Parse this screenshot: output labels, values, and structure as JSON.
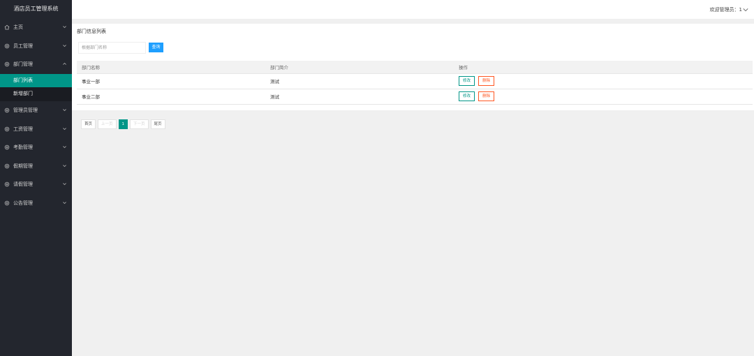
{
  "app": {
    "title": "酒店员工管理系统"
  },
  "header": {
    "welcome": "欢迎管理员：1"
  },
  "sidebar": {
    "items": [
      {
        "label": "主页",
        "icon": "home-icon",
        "chevron": "chevron-down-icon"
      },
      {
        "label": "员工管理",
        "icon": "settings-icon",
        "chevron": "chevron-down-icon"
      },
      {
        "label": "部门管理",
        "icon": "settings-icon",
        "chevron": "chevron-up-icon",
        "children": [
          {
            "label": "部门列表",
            "active": true
          },
          {
            "label": "新增部门",
            "active": false
          }
        ]
      },
      {
        "label": "管理员管理",
        "icon": "settings-icon",
        "chevron": "chevron-down-icon"
      },
      {
        "label": "工资管理",
        "icon": "settings-icon",
        "chevron": "chevron-down-icon"
      },
      {
        "label": "考勤管理",
        "icon": "settings-icon",
        "chevron": "chevron-down-icon"
      },
      {
        "label": "假期管理",
        "icon": "settings-icon",
        "chevron": "chevron-down-icon"
      },
      {
        "label": "请假管理",
        "icon": "settings-icon",
        "chevron": "chevron-down-icon"
      },
      {
        "label": "公告管理",
        "icon": "settings-icon",
        "chevron": "chevron-down-icon"
      }
    ]
  },
  "main": {
    "title": "部门信息列表",
    "search": {
      "placeholder": "根据部门名称",
      "value": "",
      "button": "查询"
    },
    "table": {
      "headers": [
        "部门名称",
        "部门简介",
        "操作"
      ],
      "rows": [
        {
          "name": "事业一部",
          "desc": "测试",
          "edit": "修改",
          "delete": "删除"
        },
        {
          "name": "事业二部",
          "desc": "测试",
          "edit": "修改",
          "delete": "删除"
        }
      ]
    },
    "pagination": {
      "first": "首页",
      "prev": "上一页",
      "current": "1",
      "next": "下一页",
      "last": "尾页"
    }
  },
  "colors": {
    "sidebar_bg": "#23262e",
    "accent": "#009688",
    "primary_btn": "#1e9fff",
    "danger": "#ff5722"
  }
}
